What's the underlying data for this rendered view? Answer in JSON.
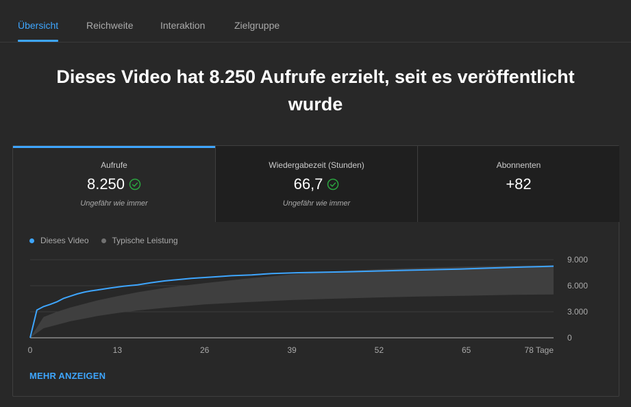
{
  "tabs": [
    {
      "label": "Übersicht",
      "active": true
    },
    {
      "label": "Reichweite",
      "active": false
    },
    {
      "label": "Interaktion",
      "active": false
    },
    {
      "label": "Zielgruppe",
      "active": false
    }
  ],
  "headline": "Dieses Video hat 8.250 Aufrufe erzielt, seit es veröffentlicht wurde",
  "metrics": [
    {
      "label": "Aufrufe",
      "value": "8.250",
      "note": "Ungefähr wie immer",
      "check": true
    },
    {
      "label": "Wiedergabezeit (Stunden)",
      "value": "66,7",
      "note": "Ungefähr wie immer",
      "check": true
    },
    {
      "label": "Abonnenten",
      "value": "+82",
      "note": "",
      "check": false
    }
  ],
  "legend": {
    "this_video": "Dieses Video",
    "typical": "Typische Leistung"
  },
  "more_link": "MEHR ANZEIGEN",
  "colors": {
    "accent": "#3ea6ff",
    "line": "#3ea6ff",
    "band": "#3f3f3f",
    "check": "#2ba640"
  },
  "chart_data": {
    "type": "area",
    "x_tick_labels": [
      "0",
      "13",
      "26",
      "39",
      "52",
      "65",
      "78 Tage"
    ],
    "x_ticks": [
      0,
      13,
      26,
      39,
      52,
      65,
      78
    ],
    "y_tick_labels": [
      "9.000",
      "6.000",
      "3.000",
      "0"
    ],
    "y_ticks": [
      9000,
      6000,
      3000,
      0
    ],
    "xlim": [
      0,
      78
    ],
    "ylim": [
      0,
      9000
    ],
    "series": [
      {
        "name": "Dieses Video",
        "x": [
          0,
          1,
          2,
          3,
          4,
          5,
          6,
          7,
          8,
          9,
          10,
          12,
          14,
          16,
          18,
          20,
          22,
          24,
          26,
          28,
          30,
          33,
          36,
          40,
          44,
          48,
          52,
          56,
          60,
          64,
          68,
          72,
          76,
          78
        ],
        "y": [
          0,
          3200,
          3600,
          3850,
          4150,
          4550,
          4800,
          5050,
          5250,
          5400,
          5500,
          5750,
          5950,
          6100,
          6350,
          6550,
          6700,
          6850,
          6950,
          7050,
          7150,
          7250,
          7400,
          7500,
          7560,
          7620,
          7700,
          7780,
          7850,
          7920,
          8020,
          8120,
          8200,
          8250
        ]
      }
    ],
    "typical_band": {
      "name": "Typische Leistung",
      "x": [
        0,
        2,
        4,
        6,
        8,
        10,
        13,
        16,
        20,
        26,
        32,
        39,
        45,
        52,
        58,
        65,
        72,
        78
      ],
      "lower": [
        0,
        1100,
        1500,
        1900,
        2200,
        2500,
        2850,
        3150,
        3450,
        3850,
        4100,
        4350,
        4500,
        4650,
        4750,
        4850,
        4950,
        5000
      ],
      "upper": [
        0,
        2400,
        3000,
        3500,
        3900,
        4300,
        4800,
        5250,
        5750,
        6300,
        6800,
        7300,
        7650,
        7900,
        8050,
        8200,
        8300,
        8350
      ]
    },
    "grid": true,
    "legend_position": "top-left"
  }
}
